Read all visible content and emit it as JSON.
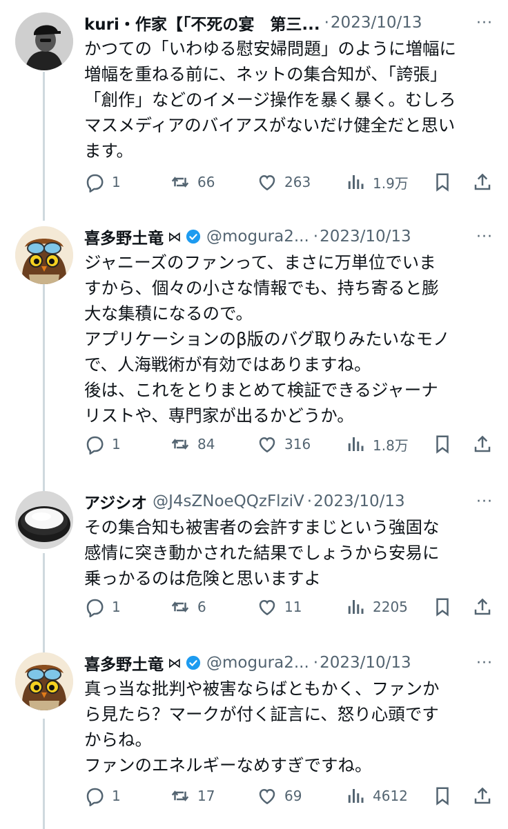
{
  "tweets": [
    {
      "name": "kuri・作家【「不死の宴　第三...",
      "handle": "",
      "date": "2023/10/13",
      "verified": false,
      "affiliate_icon": "",
      "text": "かつての「いわゆる慰安婦問題」のように増幅に\n増幅を重ねる前に、ネットの集合知が、「誇張」\n「創作」などのイメージ操作を暴く暴く。むしろ\nマスメディアのバイアスがないだけ健全だと思い\nます。",
      "replies": "1",
      "retweets": "66",
      "likes": "263",
      "views": "1.9万"
    },
    {
      "name": "喜多野土竜",
      "handle": "@mogura2...",
      "date": "2023/10/13",
      "verified": true,
      "affiliate_icon": "⋈",
      "text": "ジャニーズのファンって、まさに万単位でいま\nすから、個々の小さな情報でも、持ち寄ると膨\n大な集積になるので。\nアプリケーションのβ版のバグ取りみたいなモノ\nで、人海戦術が有効ではありますね。\n後は、これをとりまとめて検証できるジャーナ\nリストや、専門家が出るかどうか。",
      "replies": "1",
      "retweets": "84",
      "likes": "316",
      "views": "1.8万"
    },
    {
      "name": "アジシオ",
      "handle": "@J4sZNoeQQzFlziV",
      "date": "2023/10/13",
      "verified": false,
      "affiliate_icon": "",
      "text": "その集合知も被害者の会許すまじという強固な\n感情に突き動かされた結果でしょうから安易に\n乗っかるのは危険と思いますよ",
      "replies": "1",
      "retweets": "6",
      "likes": "11",
      "views": "2205"
    },
    {
      "name": "喜多野土竜",
      "handle": "@mogura2...",
      "date": "2023/10/13",
      "verified": true,
      "affiliate_icon": "⋈",
      "text": "真っ当な批判や被害ならばともかく、ファンか\nら見たら？マークが付く証言に、怒り心頭です\nからね。\nファンのエネルギーなめすぎですね。",
      "replies": "1",
      "retweets": "17",
      "likes": "69",
      "views": "4612"
    }
  ],
  "ui": {
    "date_separator": "·",
    "more_icon": "···",
    "accent_color": "#1d9bf0",
    "muted_color": "#536471",
    "thread_line_color": "#cfd9de"
  }
}
